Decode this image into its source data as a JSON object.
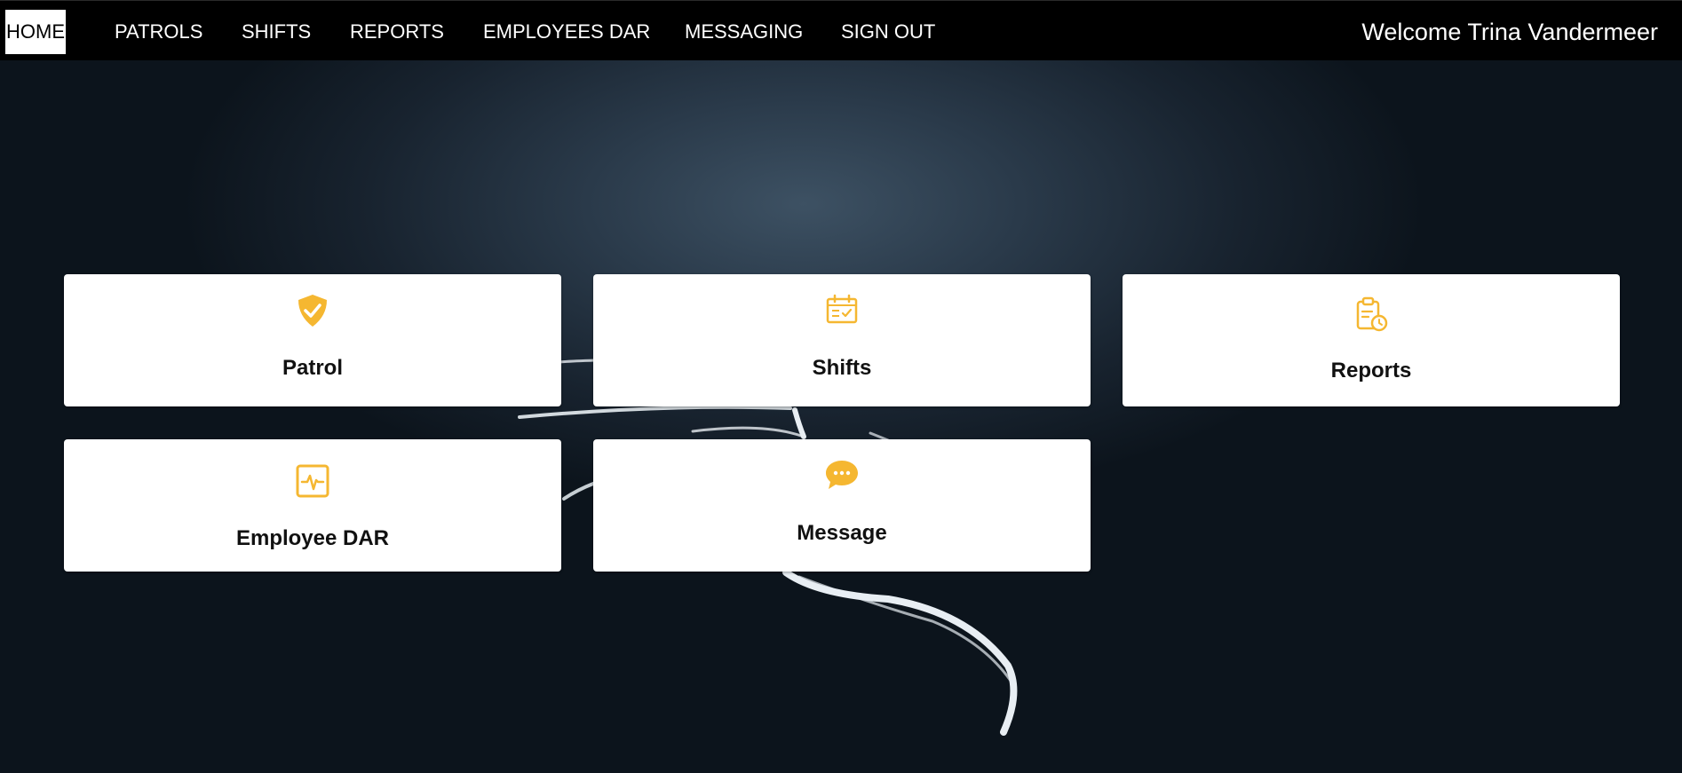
{
  "nav": {
    "items": [
      {
        "label": "HOME",
        "active": true
      },
      {
        "label": "PATROLS",
        "active": false
      },
      {
        "label": "SHIFTS",
        "active": false
      },
      {
        "label": "REPORTS",
        "active": false
      },
      {
        "label": "EMPLOYEES DAR",
        "active": false
      },
      {
        "label": "MESSAGING",
        "active": false
      },
      {
        "label": "SIGN OUT",
        "active": false
      }
    ],
    "welcome": "Welcome Trina Vandermeer"
  },
  "cards": [
    {
      "label": "Patrol",
      "icon": "shield-check-icon"
    },
    {
      "label": "Shifts",
      "icon": "calendar-check-icon"
    },
    {
      "label": "Reports",
      "icon": "clipboard-clock-icon"
    },
    {
      "label": "Employee DAR",
      "icon": "activity-pulse-icon"
    },
    {
      "label": "Message",
      "icon": "chat-bubble-icon"
    }
  ],
  "colors": {
    "nav_background": "#000000",
    "icon_accent": "#F5B731",
    "card_background": "#FFFFFF",
    "page_background": "#1B2733"
  }
}
